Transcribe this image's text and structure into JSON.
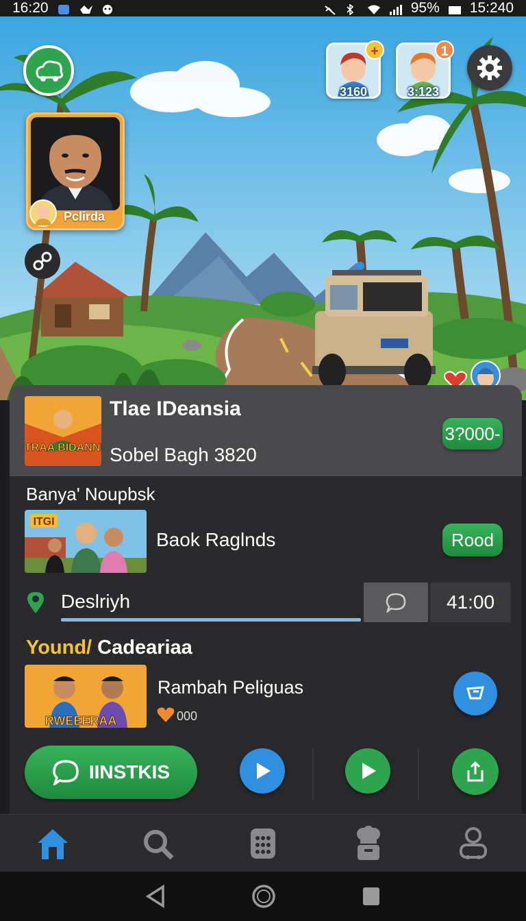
{
  "status_bar": {
    "time_left": "16:20",
    "battery": "95%",
    "time_right": "15:240"
  },
  "top_bar": {
    "friends": [
      {
        "count": "3160",
        "badge": "+"
      },
      {
        "count": "3:123",
        "badge": "1"
      }
    ]
  },
  "profile": {
    "name": "Pclirda"
  },
  "featured": {
    "thumb_text": "FUTRAA BIDANNKA",
    "title": "Tlae IDeansia",
    "subtitle": "Sobel Bagh 3820",
    "price": "3?000-"
  },
  "section_one": {
    "label": "Banya' Noupbsk",
    "thumb_text": "ITGI",
    "item_title": "Baok Raglnds",
    "action": "Rood"
  },
  "search": {
    "value": "Deslriyh",
    "time": "41:00"
  },
  "section_two": {
    "label_a": "Yound/",
    "label_b": "Cadeariaa",
    "thumb_text": "RWEEERAA",
    "item_title": "Rambah Peliguas",
    "likes": "000"
  },
  "actions": {
    "primary_label": "IINSTKIS"
  },
  "colors": {
    "accent_green": "#2ea44f",
    "accent_blue": "#2f8fe0",
    "panel": "#2a2a2c",
    "highlight_yellow": "#f4c530"
  }
}
